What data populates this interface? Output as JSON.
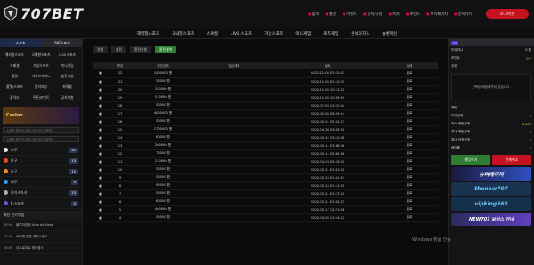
{
  "brand": {
    "name": "707BET"
  },
  "toplinks": [
    "출석",
    "충전",
    "이벤트",
    "공지/규정",
    "쪽지",
    "포인트",
    "마이페이지",
    "문의하기"
  ],
  "login_label": "로그아웃",
  "nav": [
    "해외형스포츠",
    "국내형스포츠",
    "스페셜",
    "LIVE 스포츠",
    "가상스포츠",
    "미니게임",
    "로즈게임",
    "원석카지노",
    "슬롯머신"
  ],
  "left": {
    "head": [
      "스포츠",
      "LIVE스포츠"
    ],
    "grid": [
      "해외형스포츠",
      "국내형스포츠",
      "LIVE스포츠",
      "스페셜",
      "가상스포츠",
      "미니게임",
      "홀덤",
      "라이브카지노",
      "슬롯게임",
      "룰렛/스포츠",
      "원석보상",
      "파워볼",
      "출석부",
      "쿠폰/포인트",
      "공지사항"
    ],
    "banner": "Casino",
    "search1": "스포츠 종목의 검색 (국가/리그/팀명)",
    "search2": "스포츠 종목의 검색 (국가/리그/팀명)",
    "sports": [
      {
        "name": "축구",
        "count": "41",
        "color": "#e8e8e8"
      },
      {
        "name": "야구",
        "count": "13",
        "color": "#e05020"
      },
      {
        "name": "농구",
        "count": "11",
        "color": "#f08a20"
      },
      {
        "name": "배구",
        "count": "9",
        "color": "#2aa0ff"
      },
      {
        "name": "아이스하키",
        "count": "23",
        "color": "#aaaaaa"
      },
      {
        "name": "E-스포츠",
        "count": "4",
        "color": "#7a50d0"
      }
    ],
    "live_title": "최신 인기게임",
    "live": [
      {
        "time": "06:00",
        "text": "플루미넨세 Unio de Vista"
      },
      {
        "time": "06:00",
        "text": "브뤼헤 클럽 페이스샌드"
      },
      {
        "time": "06:00",
        "text": "디트로이트 레드윙스"
      }
    ]
  },
  "tabs": [
    "전체",
    "충전",
    "환전신청",
    "환전내역"
  ],
  "table": {
    "headers": [
      "",
      "번호",
      "환전금액",
      "입금계좌",
      "날짜",
      "상태"
    ],
    "rows": [
      [
        "22",
        "1000000 원",
        "2022-12-06 02:12:03",
        "완료"
      ],
      [
        "21",
        "50000 원",
        "2022-12-06 02:12:03",
        "완료"
      ],
      [
        "20",
        "250000 원",
        "2022-12-06 10:12:22",
        "완료"
      ],
      [
        "19",
        "510000 원",
        "2022-12-06 10:09:51",
        "완료"
      ],
      [
        "18",
        "50000 원",
        "2022-07-09 13:22:44",
        "완료"
      ],
      [
        "17",
        "4000000 원",
        "2022-05-06 06:29:14",
        "완료"
      ],
      [
        "16",
        "50000 원",
        "2022-05-01 05:52:23",
        "완료"
      ],
      [
        "15",
        "1700000 원",
        "2022-04-30 03:33:32",
        "완료"
      ],
      [
        "14",
        "60000 원",
        "2022-04-12 23:12:08",
        "완료"
      ],
      [
        "13",
        "200000 원",
        "2022-04-11 03:36:08",
        "완료"
      ],
      [
        "12",
        "70000 원",
        "2022-04-11 05:40:46",
        "완료"
      ],
      [
        "11",
        "210000 원",
        "2022-04-03 05:10:20",
        "완료"
      ],
      [
        "10",
        "50000 원",
        "2022-03-31 01:31:32",
        "완료"
      ],
      [
        "9",
        "50000 원",
        "2022-03-29 01:41:57",
        "완료"
      ],
      [
        "8",
        "90000 원",
        "2022-03-23 01:11:20",
        "완료"
      ],
      [
        "7",
        "50000 원",
        "2022-03-21 01:17:20",
        "완료"
      ],
      [
        "6",
        "60000 원",
        "2022-03-21 01:32:23",
        "완료"
      ],
      [
        "5",
        "400000 원",
        "2022-03-17 12:21:08",
        "완료"
      ],
      [
        "4",
        "50000 원",
        "2022-03-09 11:14:22",
        "완료"
      ]
    ]
  },
  "right": {
    "user_level": "LV",
    "user_name": "",
    "rows": [
      {
        "label": "보유머니",
        "value": "0 원"
      },
      {
        "label": "포인트",
        "value": "0 P"
      },
      {
        "label": "쿠폰",
        "value": ""
      }
    ],
    "chat_text": "선택된 배팅내역이 없습니다.",
    "bet_rows": [
      {
        "label": "배팅",
        "value": ""
      },
      {
        "label": "보유금액",
        "value": "0"
      },
      {
        "label": "최소 배팅금액",
        "value": "5,000"
      },
      {
        "label": "최대 배팅금액",
        "value": "0"
      },
      {
        "label": "최대 당첨금액",
        "value": "0"
      },
      {
        "label": "배당률",
        "value": "0"
      }
    ],
    "btn_bet": "배팅하기",
    "btn_cancel": "전체취소",
    "promo1": "슈퍼메이저",
    "promo2": "thenew707",
    "promo3": "vipking365",
    "promo4": "NEW707 보너스 안내"
  },
  "watermark": "Windows 정품 인증"
}
